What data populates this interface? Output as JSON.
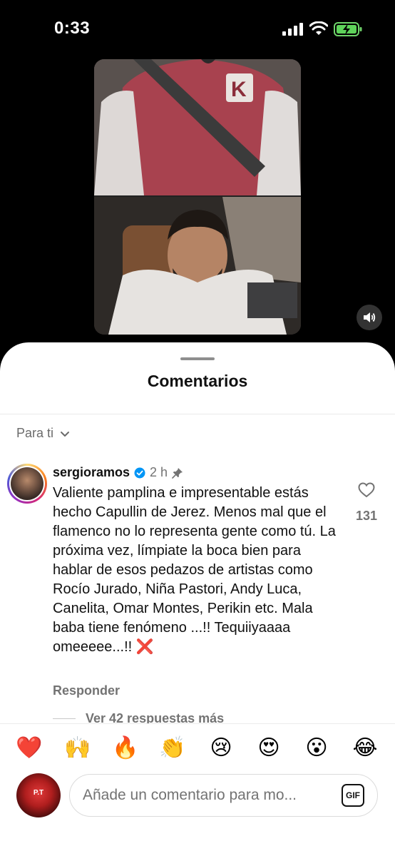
{
  "status_bar": {
    "time": "0:33"
  },
  "video": {
    "volume_icon": "speaker-icon"
  },
  "comments": {
    "title": "Comentarios",
    "sort_label": "Para ti",
    "items": [
      {
        "username": "sergioramos",
        "verified": true,
        "time": "2 h",
        "pinned": true,
        "text": "Valiente pamplina e impresentable estás hecho Capullin de Jerez. Menos mal que el flamenco no lo representa gente como tú. La próxima vez, límpiate la boca bien para hablar de esos pedazos de artistas como Rocío Jurado, Niña Pastori, Andy Luca, Canelita, Omar Montes, Perikin etc. Mala baba tiene fenómeno ...!! Tequiiyaaaa omeeeee...!!",
        "emoji": "❌",
        "likes": "131",
        "reply_label": "Responder",
        "more_replies_label": "Ver 42 respuestas más"
      }
    ]
  },
  "emoji_bar": [
    "❤️",
    "🙌",
    "🔥",
    "👏",
    "😢",
    "😍",
    "😮",
    "😂"
  ],
  "composer": {
    "placeholder": "Añade un comentario para mo...",
    "avatar_text": "P.T",
    "gif_label": "GIF"
  },
  "colors": {
    "verified": "#0095f6",
    "secondary_text": "#737373",
    "cross_mark": "#e0245e"
  }
}
